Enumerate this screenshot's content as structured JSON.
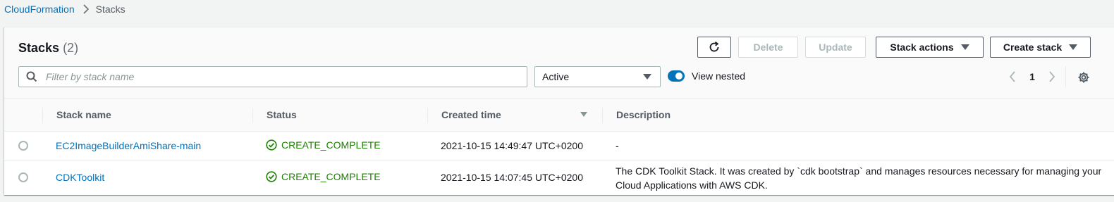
{
  "breadcrumb": {
    "root": "CloudFormation",
    "current": "Stacks"
  },
  "header": {
    "title": "Stacks",
    "count": "(2)",
    "buttons": {
      "delete": "Delete",
      "update": "Update",
      "stack_actions": "Stack actions",
      "create_stack": "Create stack"
    }
  },
  "filter": {
    "search_placeholder": "Filter by stack name",
    "search_value": "",
    "status_selected": "Active",
    "view_nested_label": "View nested",
    "view_nested_on": true
  },
  "pagination": {
    "current_page": "1"
  },
  "table": {
    "columns": [
      "Stack name",
      "Status",
      "Created time",
      "Description"
    ],
    "sort_column": "Created time",
    "sort_direction": "descending",
    "rows": [
      {
        "name": "EC2ImageBuilderAmiShare-main",
        "status": "CREATE_COMPLETE",
        "created": "2021-10-15 14:49:47 UTC+0200",
        "description": "-"
      },
      {
        "name": "CDKToolkit",
        "status": "CREATE_COMPLETE",
        "created": "2021-10-15 14:07:45 UTC+0200",
        "description": "The CDK Toolkit Stack. It was created by `cdk bootstrap` and manages resources necessary for managing your Cloud Applications with AWS CDK."
      }
    ]
  },
  "colors": {
    "link": "#0073bb",
    "success": "#1d8102",
    "toggle_on": "#0073bb"
  },
  "icons": {
    "breadcrumb_separator": "chevron-right-icon",
    "refresh": "refresh-icon",
    "search": "search-icon",
    "dropdown": "caret-down-icon",
    "prev": "chevron-left-icon",
    "next": "chevron-right-icon",
    "settings": "gear-icon",
    "status_ok": "check-circle-icon"
  }
}
